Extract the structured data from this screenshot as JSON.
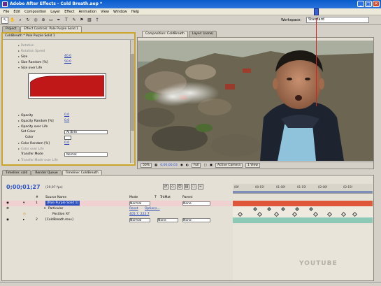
{
  "app": {
    "title": "Adobe After Effects - Cold Breath.aep *",
    "window_buttons": [
      "_",
      "□",
      "✕"
    ]
  },
  "menu": [
    "File",
    "Edit",
    "Composition",
    "Layer",
    "Effect",
    "Animation",
    "View",
    "Window",
    "Help"
  ],
  "toolbar": {
    "tools": [
      "selection-tool-icon",
      "hand-tool-icon",
      "zoom-tool-icon",
      "rotate-tool-icon",
      "camera-orbit-icon",
      "pan-behind-icon",
      "rectangle-mask-icon",
      "pen-tool-icon",
      "text-tool-icon",
      "brush-tool-icon",
      "clone-stamp-icon",
      "eraser-icon",
      "puppet-pin-icon"
    ],
    "workspace_label": "Workspace:",
    "workspace_value": "Standard"
  },
  "left_tabs": [
    "Project",
    "Effect Controls: Pale Purple Solid 1"
  ],
  "left_header": "ColdBreath * Pale Purple Solid 1",
  "effect_props": [
    {
      "label": "Rotation",
      "value": "",
      "dim": true
    },
    {
      "label": "Rotation Speed",
      "value": "",
      "dim": true
    },
    {
      "label": "Size",
      "value": "40.0",
      "dim": false
    },
    {
      "label": "Size Random [%]",
      "value": "50.0",
      "dim": false
    },
    {
      "label": "Size over Life",
      "value": "",
      "dim": false
    }
  ],
  "effect_props_lower": [
    {
      "label": "Opacity",
      "value": "0.0"
    },
    {
      "label": "Opacity Random [%]",
      "value": "0.0"
    },
    {
      "label": "Opacity over Life",
      "value": ""
    },
    {
      "label": "Set Color",
      "value": "At Birth"
    },
    {
      "label": "Color",
      "value": ""
    },
    {
      "label": "Color Random [%]",
      "value": "0.0"
    },
    {
      "label": "Color over Life",
      "value": ""
    },
    {
      "label": "Transfer Mode",
      "value": "Normal"
    },
    {
      "label": "Transfer Mode over Life",
      "value": ""
    }
  ],
  "viewer_tabs": [
    "Composition: ColdBreath",
    "Layer: (none)"
  ],
  "viewer_bar": {
    "zoom": "50%",
    "timecode": "0;00;00;03",
    "resolution": "Full",
    "camera": "Active Camera",
    "views": "1 View"
  },
  "timeline_tabs": [
    "Timeline: cold",
    "Render Queue",
    "Timeline: ColdBreath"
  ],
  "timeline": {
    "timecode": "0;00;01;27",
    "fps": "(29.97 fps)",
    "columns": [
      "#",
      "Source Name",
      "Mode",
      "T",
      "TrkMat",
      "Parent"
    ],
    "ruler_ticks": [
      "00f",
      "00:15f",
      "01:00f",
      "01:15f",
      "02:00f",
      "02:15f"
    ],
    "layers": [
      {
        "num": "1",
        "name": "[Pale Purple Solid 1]",
        "mode": "Normal",
        "trkmat": "",
        "parent": "None"
      },
      {
        "num": "",
        "name": "Particular",
        "mode": "Reset",
        "trkmat": "Options...",
        "parent": ""
      },
      {
        "num": "",
        "name": "Position XY",
        "mode": "405.7, 222.7",
        "trkmat": "",
        "parent": ""
      },
      {
        "num": "2",
        "name": "[ColdBreath.mov]",
        "mode": "Normal",
        "trkmat": "None",
        "parent": "None"
      }
    ]
  },
  "watermark": "YOUTUBE"
}
